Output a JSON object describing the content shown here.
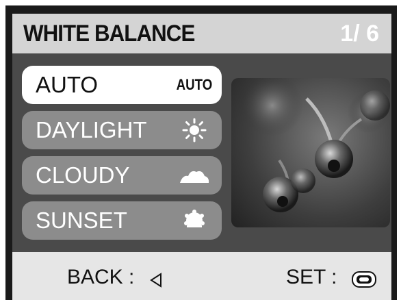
{
  "header": {
    "title": "WHITE BALANCE",
    "page_indicator": "1/ 6"
  },
  "menu": {
    "items": [
      {
        "label": "AUTO",
        "icon": "auto-text-icon",
        "icon_text": "AUTO",
        "selected": true
      },
      {
        "label": "DAYLIGHT",
        "icon": "sun-icon",
        "selected": false
      },
      {
        "label": "CLOUDY",
        "icon": "cloud-icon",
        "selected": false
      },
      {
        "label": "SUNSET",
        "icon": "sunset-icon",
        "selected": false
      }
    ]
  },
  "preview": {
    "icon": "preview-image"
  },
  "footer": {
    "back_label": "BACK :",
    "back_icon": "left-arrow-icon",
    "set_label": "SET :",
    "set_icon": "ok-button-icon"
  },
  "colors": {
    "frame": "#1a1a1a",
    "header_bg": "#d4d4d4",
    "content_bg": "#4a4a4a",
    "item_bg": "#8c8c8c",
    "item_selected_bg": "#ffffff",
    "footer_bg": "#e6e6e6"
  }
}
